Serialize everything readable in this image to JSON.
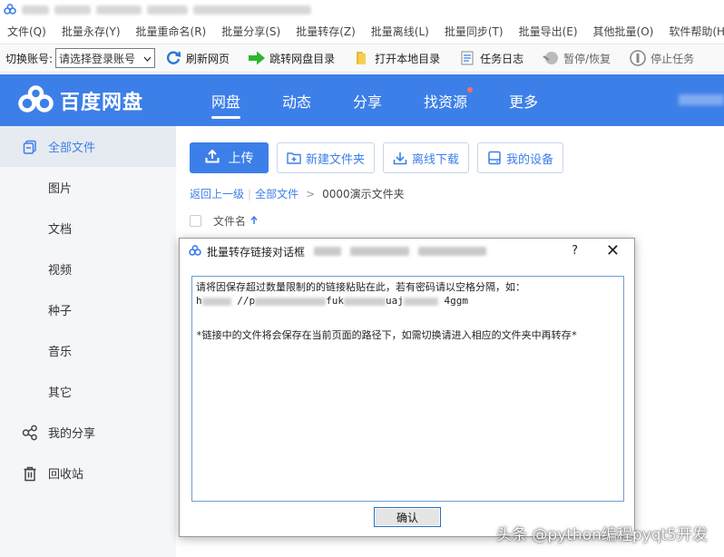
{
  "menubar": {
    "items": [
      "文件(Q)",
      "批量永存(Y)",
      "批量重命名(R)",
      "批量分享(S)",
      "批量转存(Z)",
      "批量离线(L)",
      "批量同步(T)",
      "批量导出(E)",
      "其他批量(O)",
      "软件帮助(H)"
    ]
  },
  "toolbar": {
    "account_label": "切换账号:",
    "account_value": "请选择登录账号",
    "refresh": "刷新网页",
    "jump": "跳转网盘目录",
    "open_local": "打开本地目录",
    "task_log": "任务日志",
    "pause_resume": "暂停/恢复",
    "stop_task": "停止任务"
  },
  "header": {
    "logo_text": "百度网盘",
    "nav": [
      "网盘",
      "动态",
      "分享",
      "找资源",
      "更多"
    ]
  },
  "sidebar": {
    "items": [
      "全部文件",
      "图片",
      "文档",
      "视频",
      "种子",
      "音乐",
      "其它",
      "我的分享",
      "回收站"
    ]
  },
  "main": {
    "upload": "上传",
    "new_folder": "新建文件夹",
    "offline_download": "离线下载",
    "my_device": "我的设备",
    "crumb_back": "返回上一级",
    "crumb_all": "全部文件",
    "crumb_current": "0000演示文件夹",
    "col_filename": "文件名"
  },
  "dialog": {
    "title": "批量转存链接对话框",
    "help": "?",
    "close": "✕",
    "line1": "请将因保存超过数量限制的的链接粘贴在此，若有密码请以空格分隔，如：",
    "line2_a": "h",
    "line2_b": " //p",
    "line2_c": "fuk",
    "line2_d": "uaj",
    "line2_e": " 4ggm",
    "line3": "*链接中的文件将会保存在当前页面的路径下，如需切换请进入相应的文件夹中再转存*",
    "ok": "确认"
  },
  "watermark": "头条 @python编程pyqt5开发",
  "colors": {
    "brand": "#3d7fe8",
    "sidebar_bg": "#f5f6f8",
    "dot": "#ff6b6b"
  }
}
